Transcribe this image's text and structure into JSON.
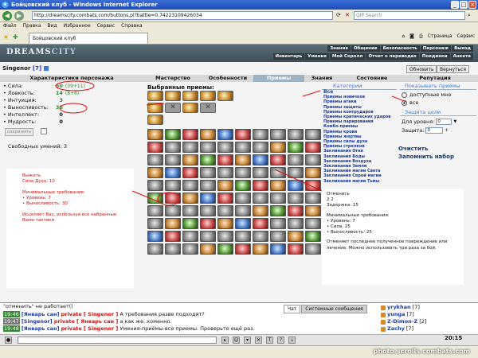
{
  "browser": {
    "title": "Бойцовский клуб - Windows Internet Explorer",
    "url": "http://dreamscity.combats.com/buttons.pl?battle=0.74223109426034",
    "search_placeholder": "QIP Search",
    "menu": [
      "Файл",
      "Правка",
      "Вид",
      "Избранное",
      "Сервис",
      "Справка"
    ],
    "tab_label": "Бойцовский клуб",
    "toolbar_right": [
      "Страница",
      "Сервис"
    ]
  },
  "game": {
    "logo_main": "DREAMS",
    "logo_sub": "CITY",
    "topmenu1": [
      "Знания",
      "Общение",
      "Безопасность",
      "Персонаж",
      "Выход"
    ],
    "topmenu2": [
      "Инвентарь",
      "Умения",
      "Мой Скролл",
      "Отчет о переводах",
      "Поединки",
      "Анкета"
    ],
    "char_name": "Singenor",
    "char_level": "[7]",
    "btn_refresh": "Обновить",
    "btn_back": "Вернуться",
    "tabs": [
      "Характеристики персонажа",
      "Мастерство",
      "Особенности",
      "Приемы",
      "Знания",
      "Состояние",
      "Репутация"
    ],
    "stats": [
      {
        "name": "Сила:",
        "value": "50",
        "bonus": "(39+11)"
      },
      {
        "name": "Ловкость:",
        "value": "14",
        "bonus": "(8+6)"
      },
      {
        "name": "Интуиция:",
        "value": "3",
        "bonus": ""
      },
      {
        "name": "Выносливость:",
        "value": "35",
        "bonus": ""
      },
      {
        "name": "Интеллект:",
        "value": "0",
        "bonus": ""
      },
      {
        "name": "Мудрость:",
        "value": "0",
        "bonus": ""
      }
    ],
    "save_label": "сохранить",
    "free_skills": "Свободных умений: 3",
    "left_tip": {
      "title": "Выжить",
      "spirit": "Сила Духа: 10",
      "req_title": "Минимальные требования:",
      "reqs": [
        "• Уровень: 7",
        "• Выносливость: 30"
      ],
      "desc": "Исцеляет Вас, используя все набранные Вами тактики."
    },
    "selected_title": "Выбранные приемы:",
    "categories_title": "Категории",
    "categories": [
      "Все",
      "Приемы новичков",
      "Приемы атаки",
      "Приемы защиты",
      "Приемы контрударов",
      "Приемы критических ударов",
      "Приемы парирования",
      "Комбо-приемы",
      "Приемы крови",
      "Приемы жертвы",
      "Приемы силы духа",
      "Приемы стрелков",
      "Заклинания Огня",
      "Заклинания Воды",
      "Заклинания Воздуха",
      "Заклинания Земли",
      "Заклинания магии Света",
      "Заклинания Серой магии",
      "Заклинания магии Тьмы"
    ],
    "show_title": "Показывать приёмы",
    "show_opt1": "доступные мне",
    "show_opt2": "все",
    "protect_title": "Защита цели",
    "level_label": "Для уровня:",
    "level_value": "0",
    "protect_label": "Защита:",
    "protect_value": "0",
    "clear_link": "Очистить",
    "remember_link": "Запомнить набор",
    "right_tip": {
      "title": "Отменить",
      "nums": "2  2",
      "delay": "Задержка: 15",
      "req_title": "Минимальные требования:",
      "reqs": [
        "• Уровень: 7",
        "• Сила: 25",
        "• Выносливость: 25"
      ],
      "desc": "Отменяет последнее полученное повреждение или лечение. Можно использовать три раза за бой."
    }
  },
  "chat": {
    "line0": "\"отменить\" не работает((",
    "messages": [
      {
        "time": "19:46",
        "from": "[Январь сан]",
        "kind": "private",
        "to": "[ Singenor ]",
        "text": "А требования разве подходят?"
      },
      {
        "time": "19:47",
        "from": "[Singenor]",
        "kind": "private",
        "to": "[ Январь сан ]",
        "text": "а как же..хоменно."
      },
      {
        "time": "19:48",
        "from": "[Январь сан]",
        "kind": "private",
        "to": "[ Singenor ]",
        "text": "Умения-приёмы-все приемы. Проверьте ещё раз."
      }
    ],
    "tabs": [
      "Чат",
      "Системные сообщения"
    ],
    "users": [
      {
        "name": "yrykhan",
        "lvl": "[7]"
      },
      {
        "name": "yunga",
        "lvl": "[7]"
      },
      {
        "name": "Z-Dimon-Z",
        "lvl": "[2]"
      },
      {
        "name": "Zachy",
        "lvl": "[7]"
      }
    ],
    "clock": "20:15"
  },
  "watermark": "photo.scrolls.combats.com"
}
